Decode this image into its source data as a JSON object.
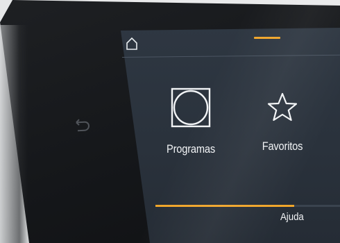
{
  "header": {
    "home_icon": "home-icon",
    "page_indicator_color": "#f0a52a"
  },
  "device": {
    "back_icon": "back-arrow-icon"
  },
  "tiles": [
    {
      "label": "Programas",
      "icon": "programs-icon"
    },
    {
      "label": "Favoritos",
      "icon": "star-icon"
    }
  ],
  "footer": {
    "help_label": "Ajuda",
    "progress": 0.75,
    "accent": "#f0a52a"
  }
}
